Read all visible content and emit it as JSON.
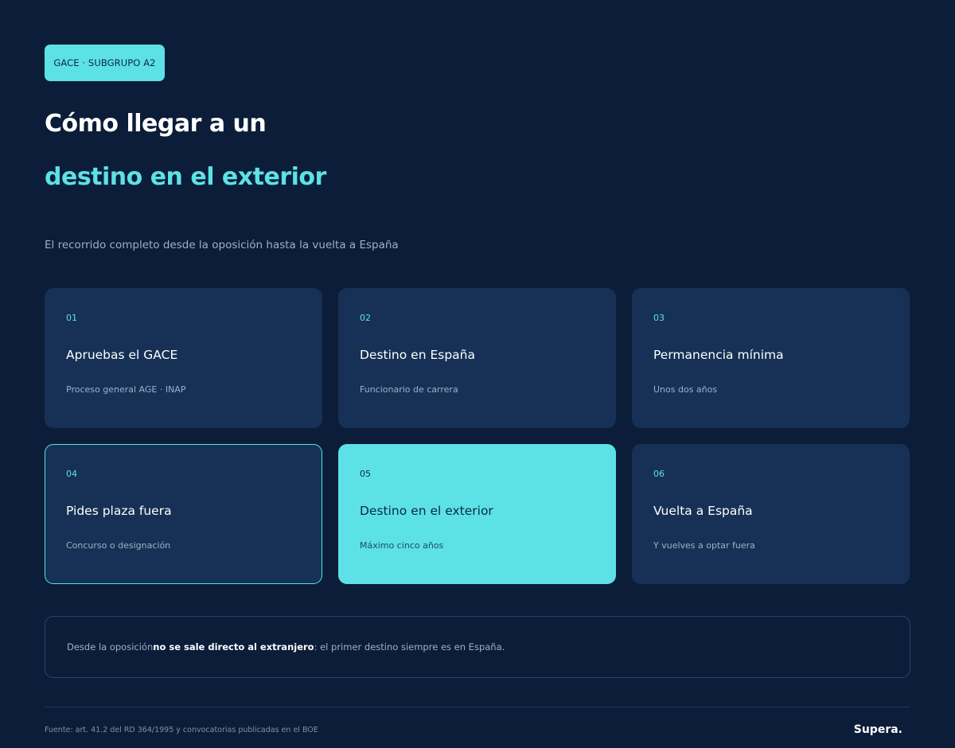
{
  "badge": {
    "label": "GACE · SUBGRUPO A2"
  },
  "header": {
    "title_line1": "Cómo llegar a un",
    "title_line2": "destino en el exterior",
    "subtitle": "El recorrido completo desde la oposición hasta la vuelta a España"
  },
  "steps": [
    {
      "number": "01",
      "title": "Apruebas el GACE",
      "description": "Proceso general AGE · INAP"
    },
    {
      "number": "02",
      "title": "Destino en España",
      "description": "Funcionario de carrera"
    },
    {
      "number": "03",
      "title": "Permanencia mínima",
      "description": "Unos dos años"
    },
    {
      "number": "04",
      "title": "Pides plaza fuera",
      "description": "Concurso o designación"
    },
    {
      "number": "05",
      "title": "Destino en el exterior",
      "description": "Máximo cinco años"
    },
    {
      "number": "06",
      "title": "Vuelta a España",
      "description": "Y vuelves a optar fuera"
    }
  ],
  "note": {
    "prefix": "Desde la oposición ",
    "emphasis": "no se sale directo al extranjero",
    "suffix": ": el primer destino siempre es en España."
  },
  "footer": {
    "source": "Fuente: art. 41.2 del RD 364/1995 y convocatorias publicadas en el BOE",
    "brand": "Supera."
  },
  "colors": {
    "background": "#0b1d38",
    "card": "#163155",
    "accent": "#5ce1e6",
    "muted_text": "#9fb0c6"
  }
}
